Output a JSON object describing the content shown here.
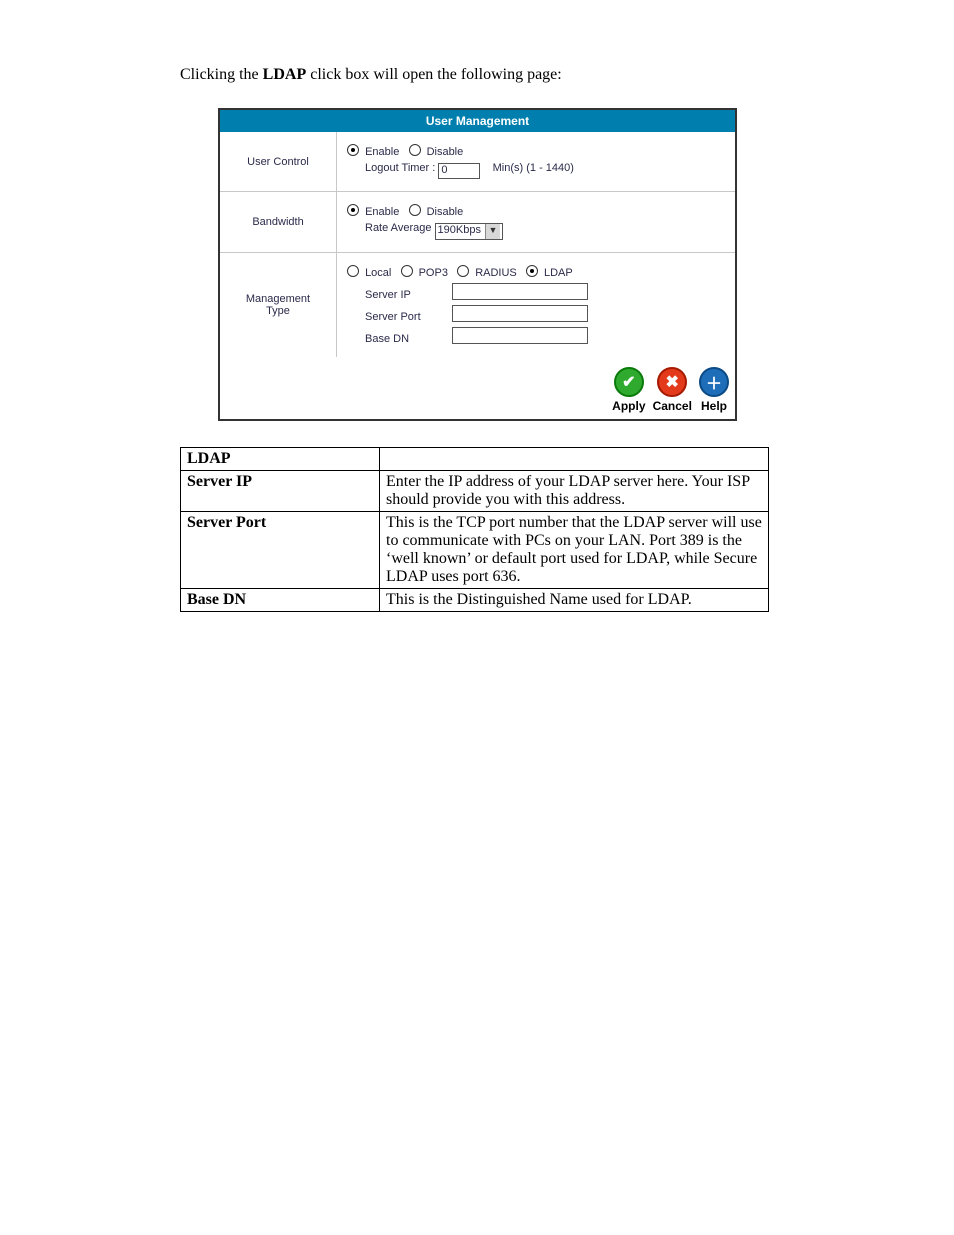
{
  "intro_pre": "Clicking the ",
  "intro_bold": "LDAP",
  "intro_post": " click box will open the following page:",
  "panel": {
    "title": "User Management",
    "user_control": {
      "label": "User Control",
      "enable": "Enable",
      "disable": "Disable",
      "logout_timer_label": "Logout Timer :",
      "logout_timer_value": "0",
      "logout_timer_hint": "Min(s) (1 - 1440)"
    },
    "bandwidth": {
      "label": "Bandwidth",
      "enable": "Enable",
      "disable": "Disable",
      "rate_average_label": "Rate Average",
      "rate_average_value": "190Kbps"
    },
    "mgmt": {
      "label_l1": "Management",
      "label_l2": "Type",
      "local": "Local",
      "pop3": "POP3",
      "radius": "RADIUS",
      "ldap": "LDAP",
      "server_ip": "Server IP",
      "server_port": "Server Port",
      "base_dn": "Base DN"
    },
    "buttons": {
      "apply": "Apply",
      "cancel": "Cancel",
      "help": "Help"
    }
  },
  "desc": {
    "ldap_h": "LDAP",
    "server_ip_h": "Server IP",
    "server_ip_d": "Enter the IP address of your LDAP server here.  Your ISP should provide you with this address.",
    "server_port_h": "Server Port",
    "server_port_d": "This is the TCP port number that the LDAP server will use to communicate with PCs on your LAN.  Port 389 is the ‘well known’ or default port used for LDAP, while Secure LDAP uses port 636.",
    "base_dn_h": "Base DN",
    "base_dn_d": "This is the Distinguished Name used for LDAP."
  }
}
